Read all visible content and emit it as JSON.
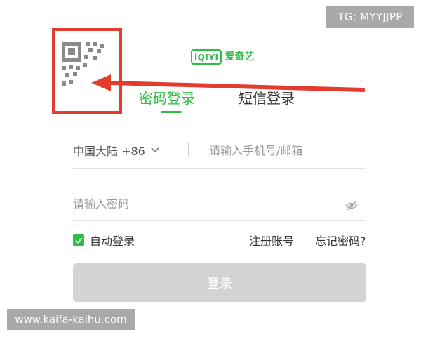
{
  "watermarks": {
    "top_right": "TG: MYYJJPP",
    "bottom_left": "www.kaifa-kaihu.com"
  },
  "logo": {
    "badge": "iQIYI",
    "text": "爱奇艺"
  },
  "tabs": [
    {
      "label": "密码登录",
      "active": true
    },
    {
      "label": "短信登录",
      "active": false
    }
  ],
  "form": {
    "country_code": "中国大陆 +86",
    "phone_placeholder": "请输入手机号/邮箱",
    "password_placeholder": "请输入密码",
    "auto_login_label": "自动登录",
    "auto_login_checked": true,
    "register_link": "注册账号",
    "forgot_link": "忘记密码?",
    "login_button": "登录"
  },
  "icons": {
    "qr": "qr-code-icon",
    "chevron": "chevron-down-icon",
    "password_visibility": "eye-slash-icon",
    "checkbox": "check-icon"
  },
  "colors": {
    "brand_green": "#2fbc45",
    "annotation_red": "#e43c2c",
    "button_disabled": "#d3d3d3"
  }
}
